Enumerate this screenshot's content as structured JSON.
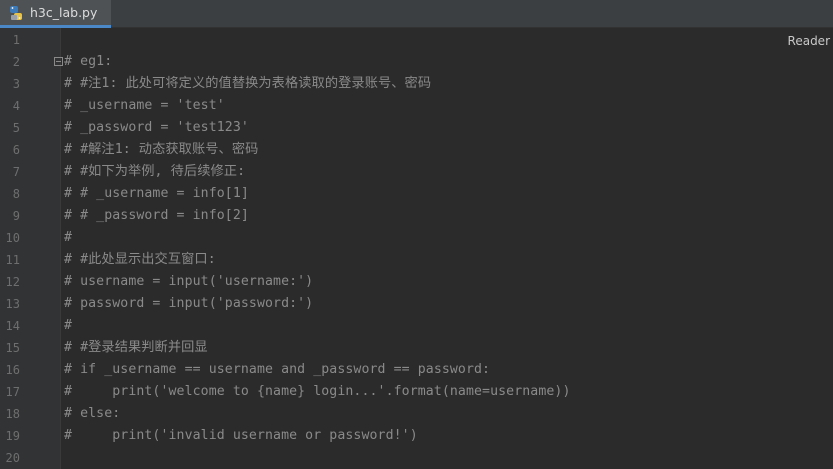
{
  "tab": {
    "filename": "h3c_lab.py",
    "icon": "python-file-icon"
  },
  "editor": {
    "reader_label": "Reader",
    "lines": [
      {
        "num": "1",
        "text": ""
      },
      {
        "num": "2",
        "text": "# eg1:"
      },
      {
        "num": "3",
        "text": "# #注1: 此处可将定义的值替换为表格读取的登录账号、密码"
      },
      {
        "num": "4",
        "text": "# _username = 'test'"
      },
      {
        "num": "5",
        "text": "# _password = 'test123'"
      },
      {
        "num": "6",
        "text": "# #解注1: 动态获取账号、密码"
      },
      {
        "num": "7",
        "text": "# #如下为举例, 待后续修正:"
      },
      {
        "num": "8",
        "text": "# # _username = info[1]"
      },
      {
        "num": "9",
        "text": "# # _password = info[2]"
      },
      {
        "num": "10",
        "text": "#"
      },
      {
        "num": "11",
        "text": "# #此处显示出交互窗口:"
      },
      {
        "num": "12",
        "text": "# username = input('username:')"
      },
      {
        "num": "13",
        "text": "# password = input('password:')"
      },
      {
        "num": "14",
        "text": "#"
      },
      {
        "num": "15",
        "text": "# #登录结果判断并回显"
      },
      {
        "num": "16",
        "text": "# if _username == username and _password == password:"
      },
      {
        "num": "17",
        "text": "#     print('welcome to {name} login...'.format(name=username))"
      },
      {
        "num": "18",
        "text": "# else:"
      },
      {
        "num": "19",
        "text": "#     print('invalid username or password!')"
      },
      {
        "num": "20",
        "text": ""
      }
    ]
  },
  "colors": {
    "background": "#2b2b2b",
    "gutter": "#313335",
    "comment": "#8a8a8a",
    "line_number": "#6e6e6e",
    "tab_accent": "#4a88c7"
  }
}
